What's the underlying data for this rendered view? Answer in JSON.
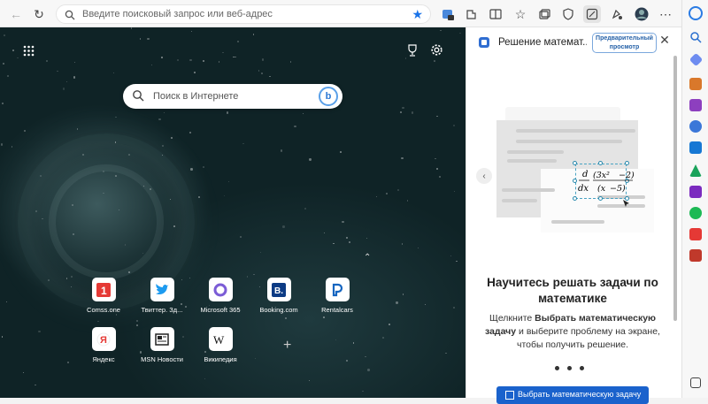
{
  "toolbar": {
    "address_placeholder": "Введите поисковый запрос или веб-адрес"
  },
  "ntp": {
    "search_placeholder": "Поиск в Интернете",
    "tiles": [
      {
        "label": "Comss.one",
        "icon": "comss-icon",
        "color": "#e53935"
      },
      {
        "label": "Твиттер. Зд...",
        "icon": "twitter-icon",
        "color": "#1d9bf0"
      },
      {
        "label": "Microsoft 365",
        "icon": "m365-icon",
        "color": "#7b5cd6"
      },
      {
        "label": "Booking.com",
        "icon": "booking-icon",
        "color": "#0c3b84"
      },
      {
        "label": "Rentalcars",
        "icon": "rentalcars-icon",
        "color": "#1565c0"
      },
      {
        "label": "Яндекс",
        "icon": "yandex-icon",
        "color": "#e53935"
      },
      {
        "label": "MSN Новости",
        "icon": "msn-news-icon",
        "color": "#222222"
      },
      {
        "label": "Википедия",
        "icon": "wikipedia-icon",
        "color": "#111111"
      }
    ]
  },
  "pane": {
    "title": "Решение математ...",
    "preview_badge": "Предварительный просмотр",
    "heading": "Научитесь решать задачи по математике",
    "body_pre": "Щелкните ",
    "body_bold": "Выбрать математическую задачу",
    "body_post": " и выберите проблему на экране, чтобы получить решение.",
    "button_label": "Выбрать математическую задачу"
  }
}
